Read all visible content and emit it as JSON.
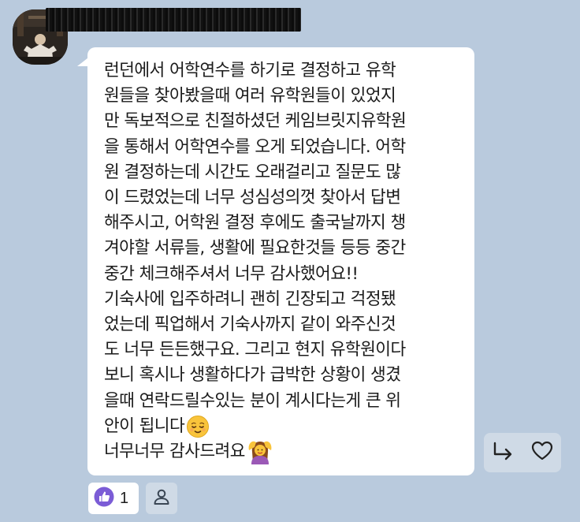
{
  "sender": {
    "name": "████████████████",
    "name_redacted": true
  },
  "message": {
    "lines": [
      "런던에서 어학연수를 하기로 결정하고 유학",
      "원들을 찾아봤을때 여러 유학원들이 있었지",
      "만 독보적으로 친절하셨던 케임브릿지유학원",
      "을 통해서 어학연수를 오게 되었습니다. 어학",
      "원 결정하는데 시간도 오래걸리고 질문도 많",
      "이 드렸었는데 너무 성심성의껏 찾아서 답변",
      "해주시고, 어학원 결정 후에도 출국날까지 챙",
      "겨야할 서류들, 생활에 필요한것들 등등 중간",
      "중간 체크해주셔서 너무 감사했어요!!",
      "기숙사에 입주하려니 괜히 긴장되고 걱정됐",
      "었는데 픽업해서 기숙사까지 같이 와주신것",
      "도 너무 든든했구요. 그리고 현지 유학원이다",
      "보니 혹시나 생활하다가 급박한 상황이 생겼",
      "을때 연락드릴수있는 분이 계시다는게 큰 위",
      "안이 됩니다",
      "너무너무 감사드려요"
    ],
    "line14_emoji": "relieved-face-emoji",
    "line15_emoji": "person-gesturing-ok-emoji"
  },
  "reactions": {
    "like_icon": "thumbs-up-icon",
    "like_count": "1",
    "add_icon": "person-icon"
  },
  "actions": {
    "reply_icon": "reply-arrow-icon",
    "heart_icon": "heart-outline-icon"
  },
  "colors": {
    "background": "#b9cadd",
    "bubble": "#ffffff",
    "like_badge": "#7b5cd6",
    "emoji_yellow": "#f9c43b"
  }
}
